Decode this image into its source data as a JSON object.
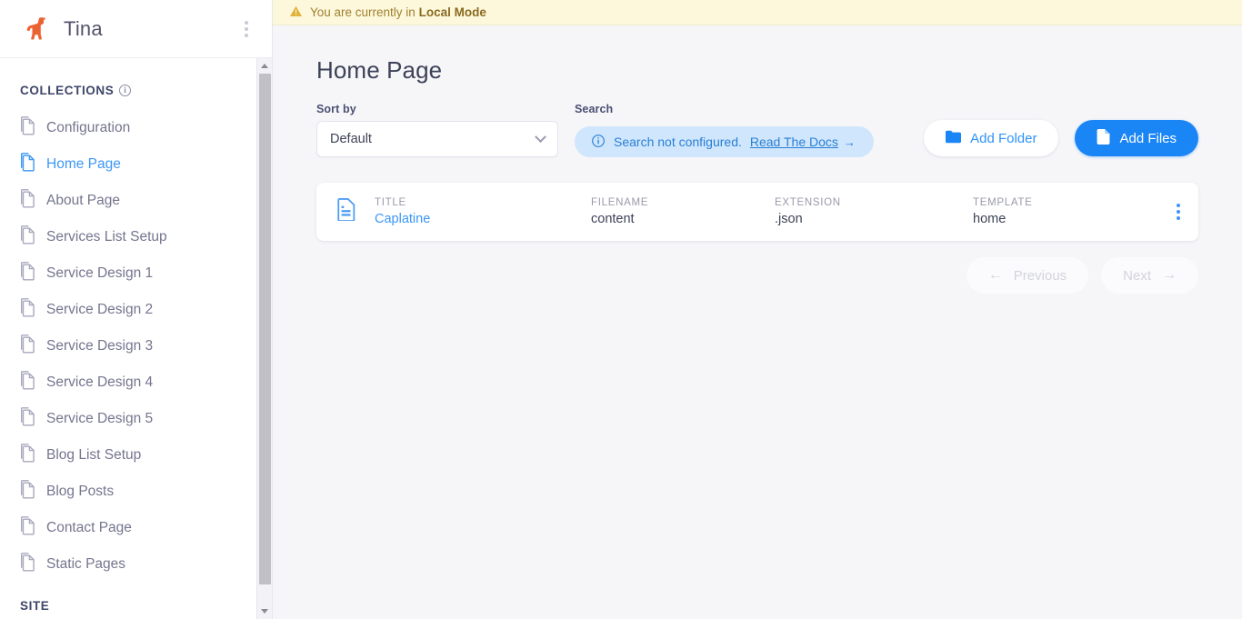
{
  "sidebar": {
    "brand": "Tina",
    "logo_icon": "llama-logo",
    "menu_icon": "kebab-menu-icon",
    "collections_label": "COLLECTIONS",
    "collections_info_icon": "info-icon",
    "site_label": "SITE",
    "items": [
      {
        "label": "Configuration",
        "icon": "document-icon",
        "active": false
      },
      {
        "label": "Home Page",
        "icon": "document-icon",
        "active": true
      },
      {
        "label": "About Page",
        "icon": "document-icon",
        "active": false
      },
      {
        "label": "Services List Setup",
        "icon": "document-icon",
        "active": false
      },
      {
        "label": "Service Design 1",
        "icon": "document-icon",
        "active": false
      },
      {
        "label": "Service Design 2",
        "icon": "document-icon",
        "active": false
      },
      {
        "label": "Service Design 3",
        "icon": "document-icon",
        "active": false
      },
      {
        "label": "Service Design 4",
        "icon": "document-icon",
        "active": false
      },
      {
        "label": "Service Design 5",
        "icon": "document-icon",
        "active": false
      },
      {
        "label": "Blog List Setup",
        "icon": "document-icon",
        "active": false
      },
      {
        "label": "Blog Posts",
        "icon": "document-icon",
        "active": false
      },
      {
        "label": "Contact Page",
        "icon": "document-icon",
        "active": false
      },
      {
        "label": "Static Pages",
        "icon": "document-icon",
        "active": false
      }
    ]
  },
  "banner": {
    "icon": "warning-triangle-icon",
    "text_prefix": "You are currently in ",
    "mode": "Local Mode"
  },
  "main": {
    "title": "Home Page",
    "sort": {
      "label": "Sort by",
      "value": "Default",
      "chevron_icon": "chevron-down-icon"
    },
    "search": {
      "label": "Search",
      "info_icon": "info-circle-icon",
      "notice": "Search not configured.",
      "docs_link": "Read The Docs",
      "arrow_icon": "arrow-right-icon"
    },
    "actions": {
      "add_folder": {
        "label": "Add Folder",
        "icon": "folder-icon"
      },
      "add_files": {
        "label": "Add Files",
        "icon": "file-icon"
      }
    },
    "table": {
      "columns": [
        "TITLE",
        "FILENAME",
        "EXTENSION",
        "TEMPLATE"
      ],
      "rows": [
        {
          "icon": "document-file-icon",
          "title": "Caplatine",
          "filename": "content",
          "extension": ".json",
          "template": "home",
          "menu_icon": "kebab-menu-icon"
        }
      ]
    },
    "pagination": {
      "previous": "Previous",
      "next": "Next",
      "prev_icon": "arrow-left-icon",
      "next_icon": "arrow-right-icon"
    }
  },
  "colors": {
    "accent_blue": "#3c97f6",
    "button_blue": "#1a85f5",
    "brand_orange": "#ec6333",
    "banner_bg": "#fdf8dc",
    "banner_text": "#a08030",
    "page_bg": "#f6f6f9",
    "notice_bg": "#cfe6fd"
  }
}
